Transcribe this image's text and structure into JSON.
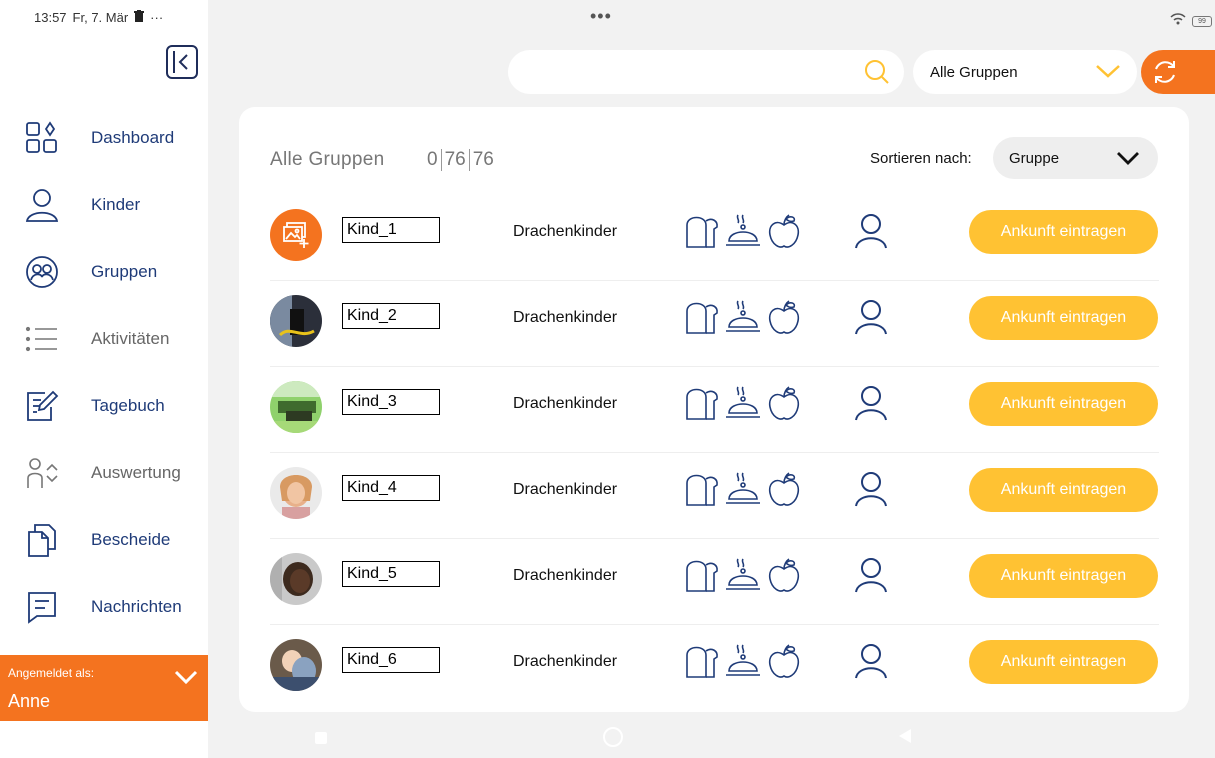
{
  "status": {
    "time": "13:57",
    "date": "Fr, 7. Mär",
    "more": "···",
    "battery": "99"
  },
  "sidebar": {
    "items": [
      {
        "label": "Dashboard",
        "icon": "dashboard-icon",
        "muted": false
      },
      {
        "label": "Kinder",
        "icon": "child-icon",
        "muted": false
      },
      {
        "label": "Gruppen",
        "icon": "group-icon",
        "muted": false
      },
      {
        "label": "Aktivitäten",
        "icon": "list-icon",
        "muted": true
      },
      {
        "label": "Tagebuch",
        "icon": "diary-icon",
        "muted": false
      },
      {
        "label": "Auswertung",
        "icon": "evaluation-icon",
        "muted": true
      },
      {
        "label": "Bescheide",
        "icon": "documents-icon",
        "muted": false
      },
      {
        "label": "Nachrichten",
        "icon": "message-icon",
        "muted": false
      }
    ],
    "login_caption": "Angemeldet als:",
    "login_name": "Anne"
  },
  "topbar": {
    "dots": "•••",
    "search_placeholder": "",
    "group_filter": "Alle Gruppen"
  },
  "main": {
    "title": "Alle Gruppen",
    "count_present": "0",
    "count_absent": "76",
    "count_total": "76",
    "sort_label": "Sortieren nach:",
    "sort_value": "Gruppe"
  },
  "colors": {
    "accent": "#f4731f",
    "button": "#ffc233",
    "icon": "#1f3b78"
  },
  "rows": [
    {
      "name": "Kind_1",
      "group": "Drachenkinder",
      "action": "Ankunft eintragen",
      "avatar": "add-photo"
    },
    {
      "name": "Kind_2",
      "group": "Drachenkinder",
      "action": "Ankunft eintragen",
      "avatar": "photo"
    },
    {
      "name": "Kind_3",
      "group": "Drachenkinder",
      "action": "Ankunft eintragen",
      "avatar": "photo"
    },
    {
      "name": "Kind_4",
      "group": "Drachenkinder",
      "action": "Ankunft eintragen",
      "avatar": "photo"
    },
    {
      "name": "Kind_5",
      "group": "Drachenkinder",
      "action": "Ankunft eintragen",
      "avatar": "photo"
    },
    {
      "name": "Kind_6",
      "group": "Drachenkinder",
      "action": "Ankunft eintragen",
      "avatar": "photo"
    }
  ]
}
